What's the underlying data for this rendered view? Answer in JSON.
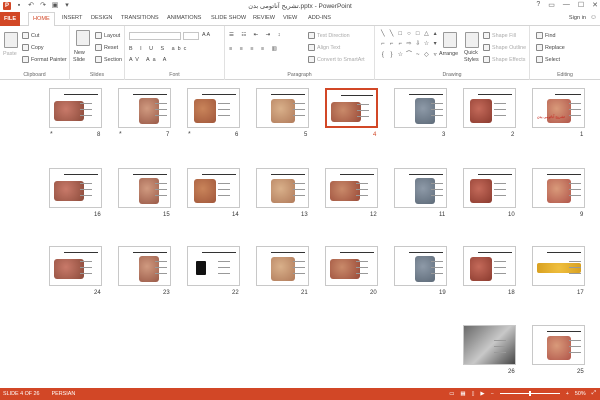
{
  "window": {
    "title": "تشريح آناتومی بدن.pptx - PowerPoint",
    "controls": [
      "?",
      "▭",
      "—",
      "☐",
      "✕"
    ]
  },
  "quick_access": {
    "logo": "P"
  },
  "tabs": [
    "FILE",
    "HOME",
    "INSERT",
    "DESIGN",
    "TRANSITIONS",
    "ANIMATIONS",
    "SLIDE SHOW",
    "REVIEW",
    "VIEW",
    "ADD-INS"
  ],
  "account": {
    "signin": "Sign in"
  },
  "ribbon": {
    "clipboard": {
      "label": "Clipboard",
      "paste": "Paste",
      "cut": "Cut",
      "copy": "Copy",
      "format_painter": "Format Painter"
    },
    "slides": {
      "label": "Slides",
      "new_slide": "New",
      "new_slide2": "Slide",
      "layout": "Layout",
      "reset": "Reset",
      "section": "Section"
    },
    "font": {
      "label": "Font"
    },
    "paragraph": {
      "label": "Paragraph",
      "text_direction": "Text Direction",
      "align_text": "Align Text",
      "convert": "Convert to SmartArt"
    },
    "drawing": {
      "label": "Drawing",
      "arrange": "Arrange",
      "quick_styles": "Quick",
      "quick_styles2": "Styles",
      "shape_fill": "Shape Fill",
      "shape_outline": "Shape Outline",
      "shape_effects": "Shape Effects"
    },
    "editing": {
      "label": "Editing",
      "find": "Find",
      "replace": "Replace",
      "select": "Select"
    }
  },
  "slides": [
    {
      "n": "1",
      "star": false
    },
    {
      "n": "2",
      "star": false
    },
    {
      "n": "3",
      "star": false
    },
    {
      "n": "4",
      "star": false,
      "selected": true
    },
    {
      "n": "5",
      "star": false
    },
    {
      "n": "6",
      "star": true
    },
    {
      "n": "7",
      "star": true
    },
    {
      "n": "8",
      "star": true
    },
    {
      "n": "9"
    },
    {
      "n": "10"
    },
    {
      "n": "11"
    },
    {
      "n": "12"
    },
    {
      "n": "13"
    },
    {
      "n": "14"
    },
    {
      "n": "15"
    },
    {
      "n": "16"
    },
    {
      "n": "17"
    },
    {
      "n": "18"
    },
    {
      "n": "19"
    },
    {
      "n": "20"
    },
    {
      "n": "21"
    },
    {
      "n": "22"
    },
    {
      "n": "23"
    },
    {
      "n": "24"
    },
    {
      "n": "25"
    },
    {
      "n": "26"
    }
  ],
  "star_symbol": "*",
  "slide_title": "تشریح آناتومی بدن",
  "status": {
    "slide_info": "SLIDE 4 OF 26",
    "language": "PERSIAN",
    "zoom": "50%",
    "zoom_level_percent": 50
  },
  "colors": {
    "accent": "#d24726"
  }
}
